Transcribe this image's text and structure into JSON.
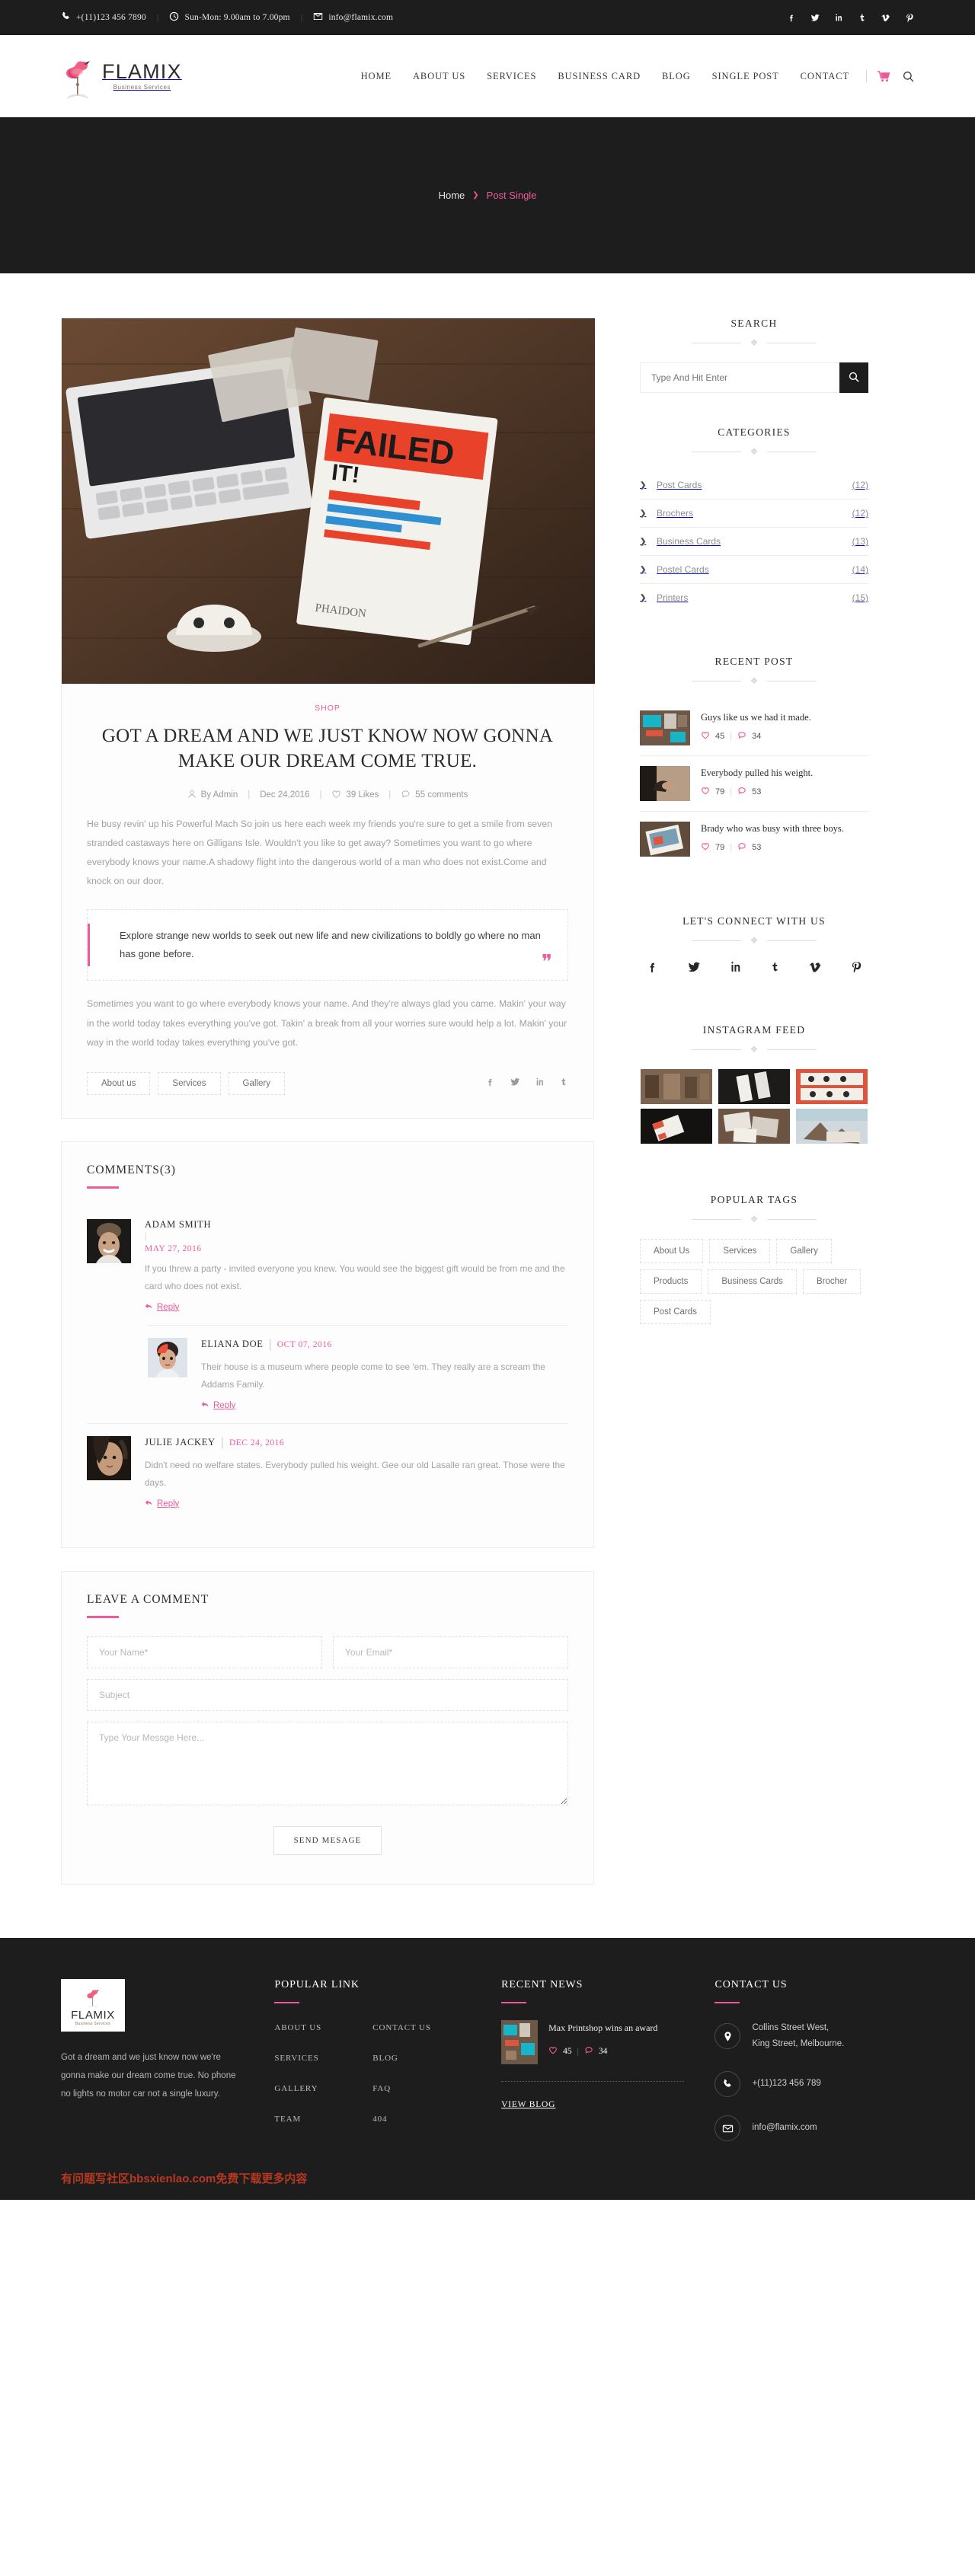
{
  "topbar": {
    "phone": "+(11)123 456 7890",
    "hours": "Sun-Mon: 9.00am to 7.00pm",
    "email": "info@flamix.com",
    "separator": "|",
    "socials": [
      "facebook",
      "twitter",
      "linkedin",
      "tumblr",
      "vimeo",
      "pinterest"
    ]
  },
  "header": {
    "brand": "FLAMIX",
    "brand_tagline": "Business Services",
    "nav": [
      "HOME",
      "ABOUT US",
      "SERVICES",
      "BUSINESS CARD",
      "BLOG",
      "SINGLE POST",
      "CONTACT"
    ],
    "cart_icon": "cart-icon",
    "search_icon": "search-icon"
  },
  "banner": {
    "home_label": "Home",
    "separator": "❯",
    "current": "Post Single"
  },
  "post": {
    "category": "SHOP",
    "title": "GOT A DREAM AND WE JUST KNOW NOW GONNA MAKE OUR DREAM COME TRUE.",
    "meta": {
      "author": "By Admin",
      "date": "Dec 24,2016",
      "likes": "39 Likes",
      "comments": "55 comments",
      "sep": "|"
    },
    "paragraph1": "He busy revin' up his Powerful Mach So join us here each week my friends you're sure to get a smile from seven stranded castaways here on Gilligans Isle. Wouldn't you like to get away? Sometimes you want to go where everybody knows your name.A shadowy flight into the dangerous world of a man who does not exist.Come and knock on our door.",
    "quote": "Explore strange new worlds to seek out new life and new civilizations to boldly go where no man has gone before.",
    "paragraph2": "Sometimes you want to go where everybody knows your name. And they're always glad you came. Makin' your way in the world today takes everything you've got. Takin' a break from all your worries sure would help a lot. Makin' your way in the world today takes everything you've got.",
    "tags": [
      "About us",
      "Services",
      "Gallery"
    ],
    "share": [
      "facebook",
      "twitter",
      "linkedin",
      "tumblr"
    ]
  },
  "comments_section": {
    "heading": "COMMENTS(3)",
    "items": [
      {
        "name": "ADAM SMITH",
        "date": "MAY 27, 2016",
        "text": "If you threw a party - invited everyone you knew. You would see the biggest gift would be from me and the card who does not exist.",
        "reply": "Reply",
        "level": 1
      },
      {
        "name": "ELIANA DOE",
        "date": "OCT 07, 2016",
        "text": "Their house is a museum where people come to see 'em. They really are a scream the Addams Family.",
        "reply": "Reply",
        "level": 2
      },
      {
        "name": "JULIE JACKEY",
        "date": "DEC 24, 2016",
        "text": "Didn't need no welfare states. Everybody pulled his weight. Gee our old Lasalle ran great. Those were the days.",
        "reply": "Reply",
        "level": 1
      }
    ]
  },
  "leave_comment": {
    "heading": "LEAVE A COMMENT",
    "name_placeholder": "Your Name*",
    "email_placeholder": "Your Email*",
    "subject_placeholder": "Subject",
    "message_placeholder": "Type Your Messge Here...",
    "submit_label": "SEND MESAGE"
  },
  "sidebar": {
    "search": {
      "title": "SEARCH",
      "placeholder": "Type And Hit Enter",
      "button_icon": "search-icon"
    },
    "categories": {
      "title": "CATEGORIES",
      "items": [
        {
          "name": "Post Cards",
          "count": "(12)"
        },
        {
          "name": "Brochers",
          "count": "(12)"
        },
        {
          "name": "Business Cards",
          "count": "(13)"
        },
        {
          "name": "Postel Cards",
          "count": "(14)"
        },
        {
          "name": "Printers",
          "count": "(15)"
        }
      ]
    },
    "recent_post": {
      "title": "RECENT POST",
      "items": [
        {
          "title": "Guys like us we had it made.",
          "likes": "45",
          "comments": "34"
        },
        {
          "title": "Everybody pulled his weight.",
          "likes": "79",
          "comments": "53"
        },
        {
          "title": "Brady who was busy with three boys.",
          "likes": "79",
          "comments": "53"
        }
      ]
    },
    "connect": {
      "title": "LET'S CONNECT WITH US",
      "socials": [
        "facebook",
        "twitter",
        "linkedin",
        "tumblr",
        "vimeo",
        "pinterest"
      ]
    },
    "instagram": {
      "title": "INSTAGRAM FEED",
      "count": 6
    },
    "popular_tags": {
      "title": "POPULAR TAGS",
      "items": [
        "About Us",
        "Services",
        "Gallery",
        "Products",
        "Business Cards",
        "Brocher",
        "Post Cards"
      ]
    }
  },
  "footer": {
    "brand": "FLAMIX",
    "brand_tagline": "Business Services",
    "about": "Got a dream and we just know now we're gonna make our dream come true. No phone no lights no motor car not a single luxury.",
    "popular_link": {
      "title": "POPULAR LINK",
      "col1": [
        "ABOUT US",
        "SERVICES",
        "GALLERY",
        "TEAM"
      ],
      "col2": [
        "CONTACT US",
        "BLOG",
        "FAQ",
        "404"
      ]
    },
    "recent_news": {
      "title": "RECENT NEWS",
      "item_title": "Max Printshop wins an award",
      "likes": "45",
      "comments": "34",
      "sep": "|",
      "view_blog": "VIEW BLOG"
    },
    "contact": {
      "title": "CONTACT US",
      "address": "Collins Street West,\nKing Street, Melbourne.",
      "phone": "+(11)123 456 789",
      "email": "info@flamix.com"
    },
    "watermark": "有问题写社区bbsxienlao.com免费下载更多内容"
  },
  "colors": {
    "accent": "#f0599a",
    "dark": "#1d1d1d",
    "body_text": "#a0a0a0"
  }
}
